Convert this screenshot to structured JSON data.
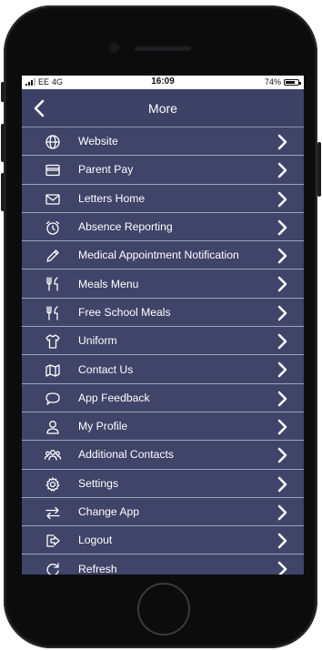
{
  "status_bar": {
    "carrier": "EE",
    "network": "4G",
    "time": "16:09",
    "battery_percent": "74%",
    "battery_level": 0.74
  },
  "header": {
    "title": "More",
    "back_icon": "chevron-left-icon"
  },
  "menu": {
    "items": [
      {
        "label": "Website",
        "icon": "globe-icon"
      },
      {
        "label": "Parent Pay",
        "icon": "credit-card-icon"
      },
      {
        "label": "Letters Home",
        "icon": "envelope-icon"
      },
      {
        "label": "Absence Reporting",
        "icon": "alarm-clock-icon"
      },
      {
        "label": "Medical Appointment Notification",
        "icon": "pencil-icon"
      },
      {
        "label": "Meals Menu",
        "icon": "fork-knife-icon"
      },
      {
        "label": "Free School Meals",
        "icon": "fork-knife-icon"
      },
      {
        "label": "Uniform",
        "icon": "t-shirt-icon"
      },
      {
        "label": "Contact Us",
        "icon": "map-icon"
      },
      {
        "label": "App Feedback",
        "icon": "speech-bubble-icon"
      },
      {
        "label": "My Profile",
        "icon": "user-icon"
      },
      {
        "label": "Additional Contacts",
        "icon": "group-icon"
      },
      {
        "label": "Settings",
        "icon": "gear-icon"
      },
      {
        "label": "Change App",
        "icon": "swap-arrows-icon"
      },
      {
        "label": "Logout",
        "icon": "logout-icon"
      },
      {
        "label": "Refresh",
        "icon": "refresh-icon"
      }
    ]
  },
  "colors": {
    "menu_background": "#3f4468",
    "divider": "#a0a3bd",
    "text": "#ffffff"
  }
}
